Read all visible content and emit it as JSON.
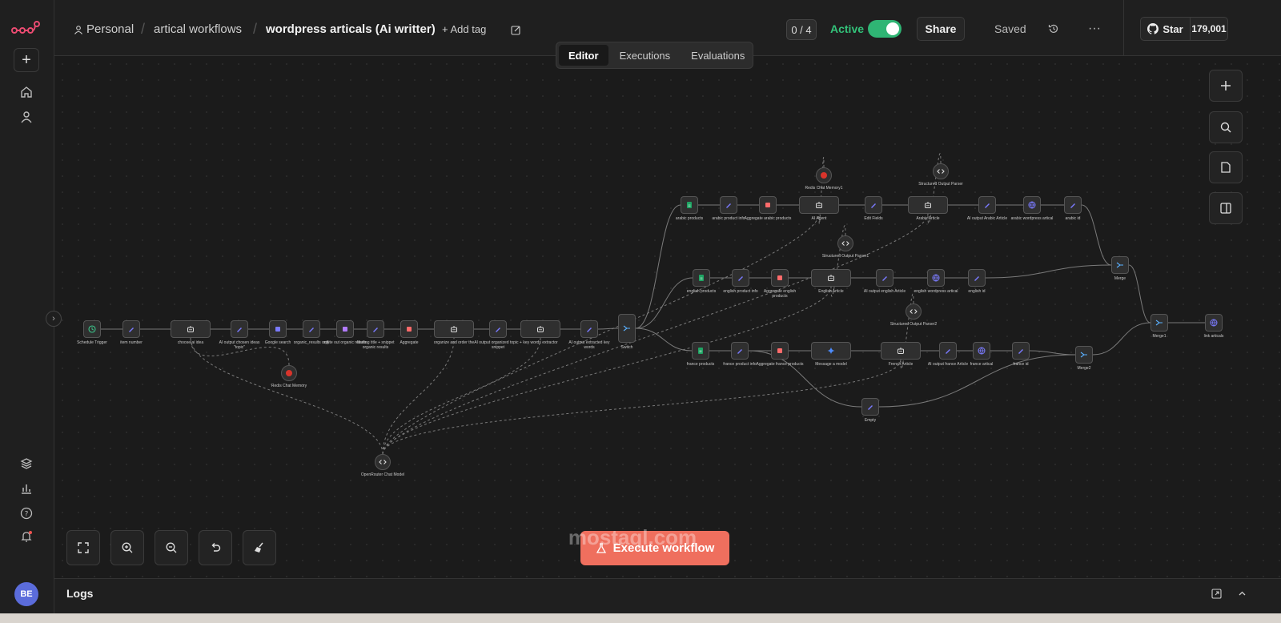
{
  "breadcrumb": {
    "project": "Personal",
    "folder": "artical workflows",
    "workflow": "wordpress articals (Ai writter)",
    "add_tag": "+ Add tag"
  },
  "header": {
    "counter": "0 / 4",
    "status_label": "Active",
    "share_label": "Share",
    "saved_label": "Saved",
    "github_label": "Star",
    "github_count": "179,001"
  },
  "tabs": [
    "Editor",
    "Executions",
    "Evaluations"
  ],
  "execute_label": "Execute workflow",
  "logs_label": "Logs",
  "user_initials": "BE",
  "watermark": "mostaql.com",
  "colors": {
    "accent": "#ef6f5e",
    "active_green": "#2fb574",
    "brand": "#ea4b71"
  },
  "nodes": [
    {
      "label": "Schedule Trigger",
      "icon": "clock-icon"
    },
    {
      "label": "item number",
      "icon": "pen-icon"
    },
    {
      "label": "choose ai idea",
      "icon": "robot-icon"
    },
    {
      "label": "AI output chosen ideas \"topic\"",
      "icon": "pen-icon"
    },
    {
      "label": "Google search",
      "icon": "grid-icon"
    },
    {
      "label": "organic_results only",
      "icon": "pen-icon"
    },
    {
      "label": "splite out organic results",
      "icon": "split-icon"
    },
    {
      "label": "filtering title + snippet organic results",
      "icon": "pen-icon"
    },
    {
      "label": "Aggregate",
      "icon": "aggregate-icon"
    },
    {
      "label": "organize and order the",
      "icon": "robot-icon"
    },
    {
      "label": "AI output organized topic + snippet",
      "icon": "pen-icon"
    },
    {
      "label": "key words extractor",
      "icon": "robot-icon"
    },
    {
      "label": "AI output extracted key words",
      "icon": "pen-icon"
    },
    {
      "label": "Switch",
      "icon": "switch-icon"
    },
    {
      "label": "Redis Chat Memory",
      "icon": "redis-icon"
    },
    {
      "label": "OpenRouter Chat Model",
      "icon": "router-icon"
    },
    {
      "label": "arabic products",
      "icon": "sheet-icon"
    },
    {
      "label": "arabic product info",
      "icon": "pen-icon"
    },
    {
      "label": "Aggregate arabic products",
      "icon": "aggregate-icon"
    },
    {
      "label": "AI Agent",
      "icon": "robot-icon"
    },
    {
      "label": "Redis Chat Memory1",
      "icon": "redis-icon"
    },
    {
      "label": "Edit Fields",
      "icon": "pen-icon"
    },
    {
      "label": "Arabic Article",
      "icon": "robot-icon"
    },
    {
      "label": "Structured Output Parser",
      "icon": "code-icon"
    },
    {
      "label": "AI output Arabic Article",
      "icon": "pen-icon"
    },
    {
      "label": "arabic wordpress artical",
      "icon": "globe-icon"
    },
    {
      "label": "arabic id",
      "icon": "pen-icon"
    },
    {
      "label": "english products",
      "icon": "sheet-icon"
    },
    {
      "label": "english product info",
      "icon": "pen-icon"
    },
    {
      "label": "Aggregate english products",
      "icon": "aggregate-icon"
    },
    {
      "label": "English Article",
      "icon": "robot-icon"
    },
    {
      "label": "Structured Output Parser1",
      "icon": "code-icon"
    },
    {
      "label": "AI output english Article",
      "icon": "pen-icon"
    },
    {
      "label": "english wordpress artical",
      "icon": "globe-icon"
    },
    {
      "label": "english id",
      "icon": "pen-icon"
    },
    {
      "label": "france products",
      "icon": "sheet-icon"
    },
    {
      "label": "france product info",
      "icon": "pen-icon"
    },
    {
      "label": "Aggregate france products",
      "icon": "aggregate-icon"
    },
    {
      "label": "Message a model",
      "icon": "gemini-icon"
    },
    {
      "label": "French Article",
      "icon": "robot-icon"
    },
    {
      "label": "Structured Output Parser2",
      "icon": "code-icon"
    },
    {
      "label": "AI output france Article",
      "icon": "pen-icon"
    },
    {
      "label": "france artical",
      "icon": "globe-icon"
    },
    {
      "label": "france id",
      "icon": "pen-icon"
    },
    {
      "label": "Merge",
      "icon": "merge-icon"
    },
    {
      "label": "Merge1",
      "icon": "merge-icon"
    },
    {
      "label": "Merge2",
      "icon": "merge-icon"
    },
    {
      "label": "link articals",
      "icon": "globe-icon"
    },
    {
      "label": "Empty",
      "icon": "pen-icon"
    }
  ]
}
